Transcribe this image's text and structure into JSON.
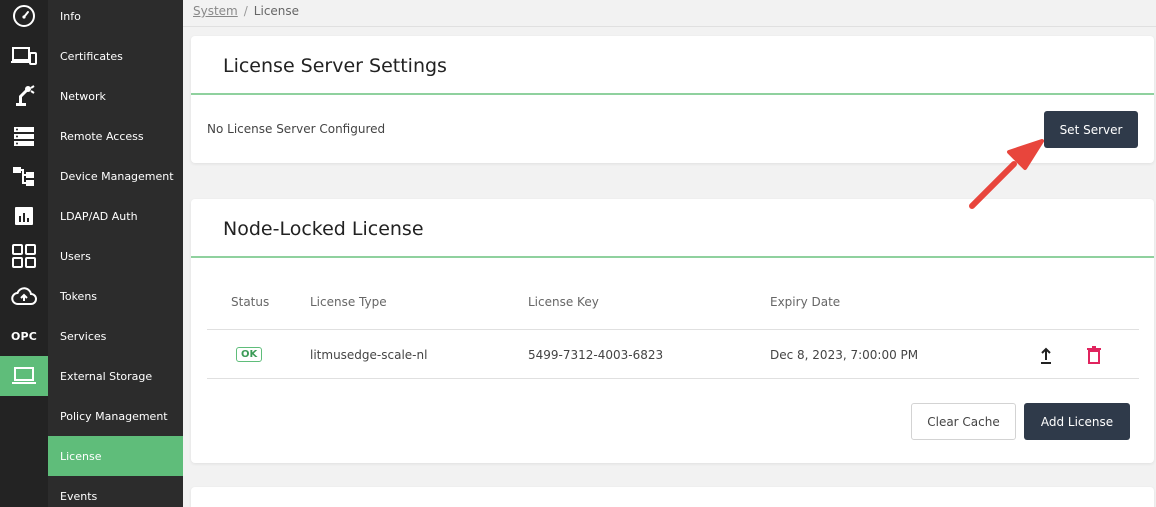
{
  "nav": {
    "rail_icons": [
      "dashboard-icon",
      "devices-icon",
      "robot-arm-icon",
      "server-icon",
      "flow-icon",
      "analytics-icon",
      "apps-grid-icon",
      "cloud-upload-icon",
      "opc-icon",
      "laptop-icon"
    ],
    "opc_label": "OPC",
    "items": [
      {
        "label": "Info"
      },
      {
        "label": "Certificates"
      },
      {
        "label": "Network"
      },
      {
        "label": "Remote Access"
      },
      {
        "label": "Device Management"
      },
      {
        "label": "LDAP/AD Auth"
      },
      {
        "label": "Users"
      },
      {
        "label": "Tokens"
      },
      {
        "label": "Services"
      },
      {
        "label": "External Storage"
      },
      {
        "label": "Policy Management"
      },
      {
        "label": "License"
      },
      {
        "label": "Events"
      }
    ],
    "active_item": "License"
  },
  "breadcrumb": {
    "parent": "System",
    "separator": "/",
    "current": "License"
  },
  "license_server": {
    "title": "License Server Settings",
    "message": "No License Server Configured",
    "set_server_label": "Set Server"
  },
  "node_locked": {
    "title": "Node-Locked License",
    "columns": [
      "Status",
      "License Type",
      "License Key",
      "Expiry Date"
    ],
    "rows": [
      {
        "status": "OK",
        "license_type": "litmusedge-scale-nl",
        "license_key": "5499-7312-4003-6823",
        "expiry_date": "Dec 8, 2023, 7:00:00 PM"
      }
    ],
    "clear_cache_label": "Clear Cache",
    "add_license_label": "Add License"
  },
  "colors": {
    "accent_green": "#5fbd7a",
    "dark_button": "#2f3a4a",
    "delete_red": "#e0245e",
    "annotation_arrow": "#e8453c"
  }
}
